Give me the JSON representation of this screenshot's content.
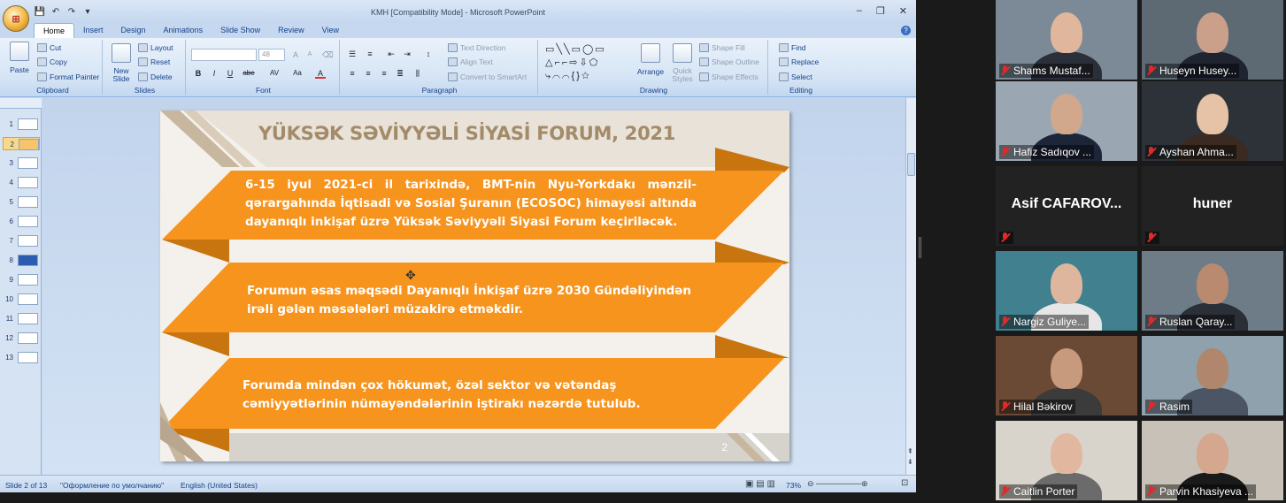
{
  "window": {
    "title": "KMH [Compatibility Mode] - Microsoft PowerPoint",
    "minimize": "‒",
    "restore": "❐",
    "close": "✕",
    "office_button": "⊞"
  },
  "tabs": [
    "Home",
    "Insert",
    "Design",
    "Animations",
    "Slide Show",
    "Review",
    "View"
  ],
  "ribbon": {
    "clipboard": {
      "label": "Clipboard",
      "paste": "Paste",
      "cut": "Cut",
      "copy": "Copy",
      "format_painter": "Format Painter"
    },
    "slides": {
      "label": "Slides",
      "new_slide": "New Slide",
      "layout": "Layout",
      "reset": "Reset",
      "delete": "Delete"
    },
    "font": {
      "label": "Font",
      "size": "48",
      "bold": "B",
      "italic": "I",
      "underline": "U",
      "strike": "abe",
      "spacing": "AV",
      "case": "Aa",
      "grow": "A",
      "shrink": "A",
      "color": "A"
    },
    "paragraph": {
      "label": "Paragraph",
      "text_direction": "Text Direction",
      "align_text": "Align Text",
      "convert": "Convert to SmartArt"
    },
    "drawing": {
      "label": "Drawing",
      "arrange": "Arrange",
      "quick_styles": "Quick Styles",
      "shape_fill": "Shape Fill",
      "shape_outline": "Shape Outline",
      "shape_effects": "Shape Effects"
    },
    "editing": {
      "label": "Editing",
      "find": "Find",
      "replace": "Replace",
      "select": "Select"
    }
  },
  "slide_numbers": [
    "1",
    "2",
    "3",
    "4",
    "5",
    "6",
    "7",
    "8",
    "9",
    "10",
    "11",
    "12",
    "13"
  ],
  "slide": {
    "title": "YÜKSƏK SƏVİYYƏLİ SİYASİ FORUM, 2021",
    "banner1": "6-15 iyul 2021-ci il tarixində, BMT-nin Nyu-Yorkdakı mənzil-qərargahında İqtisadi və Sosial Şuranın (ECOSOC) himayəsi altında dayanıqlı inkişaf üzrə Yüksək Səviyyəli Siyasi Forum keçiriləcək.",
    "banner2": "Forumun əsas məqsədi Dayanıqlı İnkişaf üzrə 2030 Gündəliyindən irəli gələn məsələləri müzakirə etməkdir.",
    "banner3": "Forumda mindən çox hökumət, özəl sektor və vətəndaş cəmiyyətlərinin nümayəndələrinin iştirakı nəzərdə tutulub.",
    "number": "2"
  },
  "status": {
    "slide": "Slide 2 of 13",
    "theme": "\"Оформление по умолчанию\"",
    "language": "English (United States)",
    "zoom": "73%"
  },
  "participants": [
    {
      "name": "Shams Mustaf...",
      "muted": true,
      "video": true
    },
    {
      "name": "Huseyn Husey...",
      "muted": true,
      "video": true
    },
    {
      "name": "Hafiz Sadıqov ...",
      "muted": true,
      "video": true
    },
    {
      "name": "Ayshan Ahma...",
      "muted": true,
      "video": true
    },
    {
      "name": "Asif  CAFAROV...",
      "muted": true,
      "video": false
    },
    {
      "name": "huner",
      "muted": true,
      "video": false
    },
    {
      "name": "Nargiz Guliye...",
      "muted": true,
      "video": true
    },
    {
      "name": "Ruslan Qaray...",
      "muted": true,
      "video": true
    },
    {
      "name": "Hilal Bəkirov",
      "muted": true,
      "video": true
    },
    {
      "name": "Rasim",
      "muted": true,
      "video": true
    },
    {
      "name": "Caitlin Porter",
      "muted": true,
      "video": true
    },
    {
      "name": "Parvin Khasiyeva ...",
      "muted": true,
      "video": true
    }
  ],
  "colors": {
    "banner_orange": "#f7941d",
    "banner_dark": "#c8740f",
    "title_tan": "#a38b6a"
  }
}
